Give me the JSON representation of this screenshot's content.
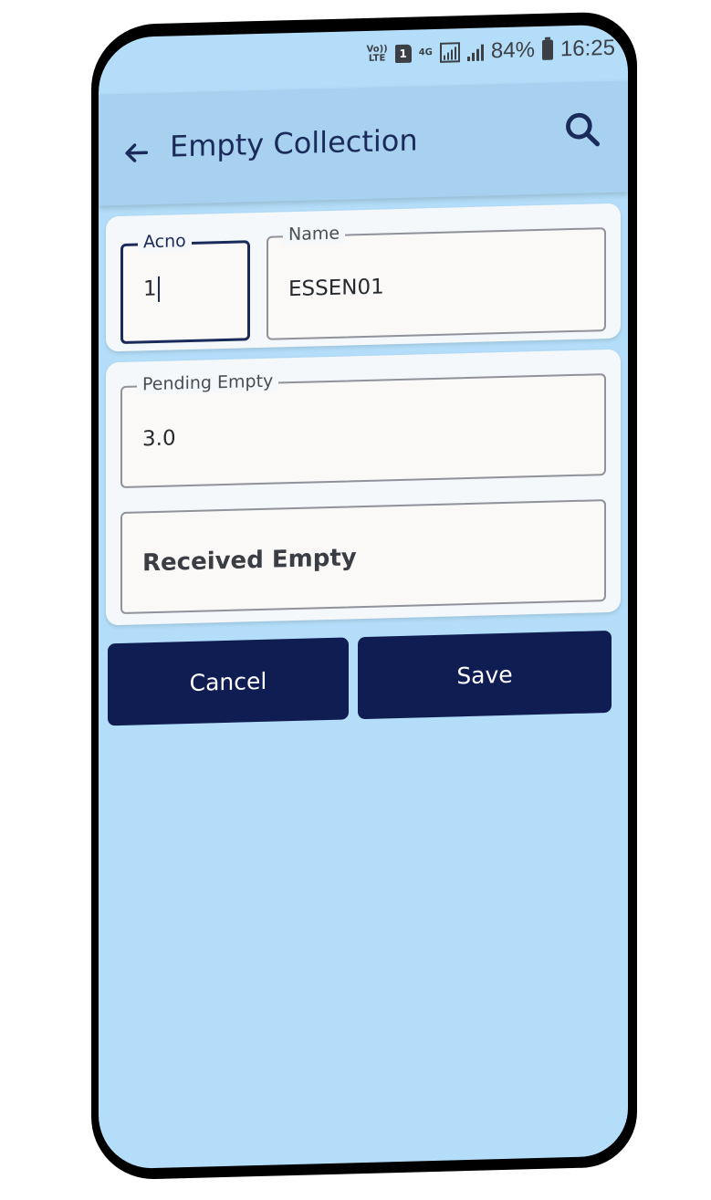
{
  "status_bar": {
    "volte_top": "Vo))",
    "volte_bottom": "LTE",
    "sim": "1",
    "network": "4G",
    "battery": "84%",
    "time": "16:25"
  },
  "app_bar": {
    "title": "Empty Collection",
    "back_icon": "arrow-left-icon",
    "search_icon": "search-icon"
  },
  "form": {
    "acno": {
      "label": "Acno",
      "value": "1"
    },
    "name": {
      "label": "Name",
      "value": "ESSEN01"
    },
    "pending_empty": {
      "label": "Pending Empty",
      "value": "3.0"
    },
    "received_empty": {
      "placeholder": "Received Empty",
      "value": ""
    }
  },
  "actions": {
    "cancel_label": "Cancel",
    "save_label": "Save"
  },
  "colors": {
    "background": "#b3ddf8",
    "app_bar": "#a7d1ee",
    "primary": "#0f1d53",
    "title_text": "#1a2a5a",
    "card": "#f4f8fb"
  }
}
